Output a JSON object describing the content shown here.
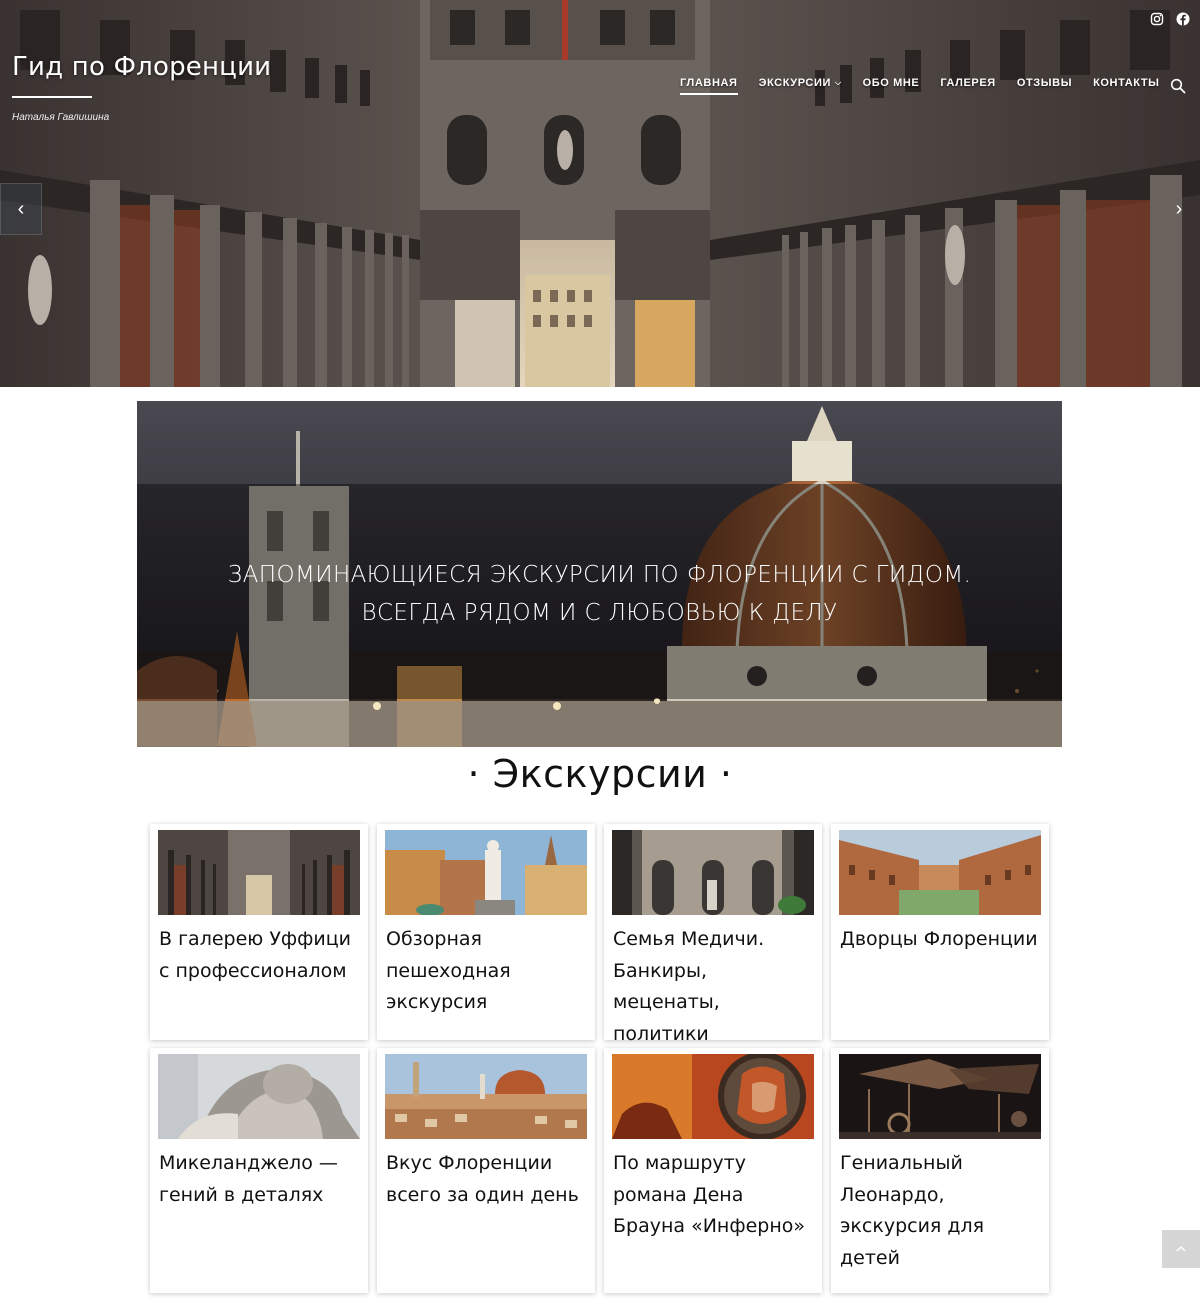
{
  "header": {
    "site_title": "Гид по Флоренции",
    "tagline": "Наталья Гавлишина",
    "social": [
      "instagram-icon",
      "facebook-icon"
    ],
    "nav": [
      {
        "label": "Главная",
        "active": true
      },
      {
        "label": "Экскурсии",
        "has_submenu": true
      },
      {
        "label": "Обо мне"
      },
      {
        "label": "Галерея"
      },
      {
        "label": "Отзывы"
      },
      {
        "label": "Контакты"
      }
    ],
    "search_icon": "search-icon"
  },
  "slider": {
    "prev_arrow": "‹",
    "next_arrow": "›"
  },
  "banner": {
    "line1": "ЗАПОМИНАЮЩИЕСЯ ЭКСКУРСИИ ПО ФЛОРЕНЦИИ С ГИДОМ.",
    "line2": "ВСЕГДА РЯДОМ И С ЛЮБОВЬЮ К ДЕЛУ"
  },
  "tours": {
    "heading": "· Экскурсии ·",
    "cards": [
      {
        "title": "В галерею  Уффици с профессионалом",
        "image": "uffizi-courtyard"
      },
      {
        "title": "Обзорная пешеходная экскурсия",
        "image": "piazza-signoria"
      },
      {
        "title": "Семья Медичи. Банкиры, меценаты, политики",
        "image": "medici-courtyard"
      },
      {
        "title": "Дворцы Флоренции",
        "image": "pitti-palace"
      },
      {
        "title": "Микеланджело — гений в деталях",
        "image": "david-statue"
      },
      {
        "title": "Вкус Флоренции всего за один день",
        "image": "florence-panorama"
      },
      {
        "title": "По маршруту романа Дена Брауна «Инферно»",
        "image": "dante-portrait"
      },
      {
        "title": "Гениальный Леонардо, экскурсия для детей",
        "image": "leonardo-machines"
      }
    ]
  },
  "back_to_top": "^"
}
